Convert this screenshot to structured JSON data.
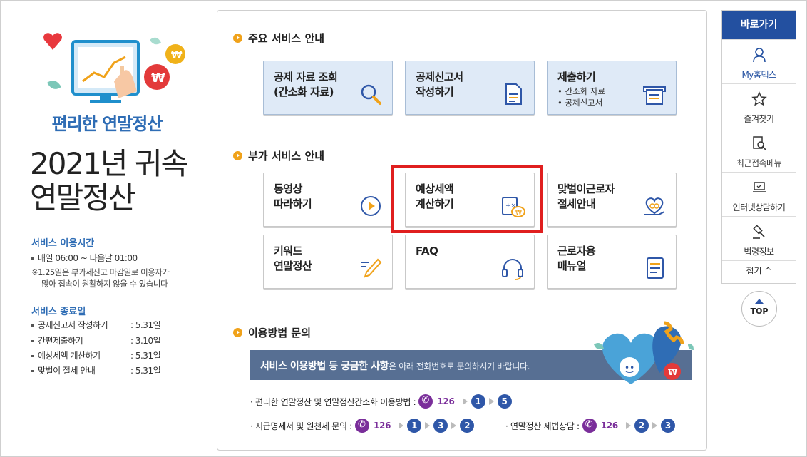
{
  "left": {
    "subtitle": "편리한 연말정산",
    "title_line1": "2021년 귀속",
    "title_line2": "연말정산",
    "service_hours": {
      "heading": "서비스 이용시간",
      "line1": "매일 06:00 ~ 다음날 01:00",
      "note1": "※1.25일은 부가세신고 마감일로 이용자가",
      "note2": "많아 접속이 원활하지 않을 수 있습니다"
    },
    "service_end": {
      "heading": "서비스 종료일",
      "items": [
        {
          "label": "공제신고서 작성하기",
          "date": ": 5.31일"
        },
        {
          "label": "간편제출하기",
          "date": ": 3.10일"
        },
        {
          "label": "예상세액 계산하기",
          "date": ": 5.31일"
        },
        {
          "label": "맞벌이 절세 안내",
          "date": ": 5.31일"
        }
      ]
    }
  },
  "main": {
    "section1": "주요 서비스 안내",
    "section2": "부가 서비스 안내",
    "section3": "이용방법 문의",
    "main_cards": [
      {
        "title": "공제 자료 조회\n(간소화 자료)",
        "sub": "",
        "icon": "search-icon"
      },
      {
        "title": "공제신고서\n작성하기",
        "sub": "",
        "icon": "document-icon"
      },
      {
        "title": "제출하기",
        "sub": "• 간소화 자료\n• 공제신고서",
        "icon": "submit-tray-icon"
      }
    ],
    "extra_cards": [
      {
        "title": "동영상\n따라하기",
        "icon": "play-icon"
      },
      {
        "title": "예상세액\n계산하기",
        "icon": "calculator-icon"
      },
      {
        "title": "맞벌이근로자\n절세안내",
        "icon": "heart-hand-icon"
      },
      {
        "title": "키워드\n연말정산",
        "icon": "pencil-icon"
      },
      {
        "title": "FAQ",
        "icon": "headset-icon"
      },
      {
        "title": "근로자용\n매뉴얼",
        "icon": "manual-icon"
      }
    ],
    "banner": {
      "bold": "서비스 이용방법 등 궁금한 사항",
      "rest": "은 아래 전화번호로 문의하시기 바랍니다."
    },
    "contacts": {
      "line1_label": "· 편리한 연말정산 및 연말정산간소화 이용방법 :",
      "line1_number": "126",
      "line1_steps": [
        "1",
        "5"
      ],
      "line2_label": "· 지급명세서 및 원천세 문의 :",
      "line2_number": "126",
      "line2_steps": [
        "1",
        "3",
        "2"
      ],
      "line3_label": "· 연말정산 세법상담 :",
      "line3_number": "126",
      "line3_steps": [
        "2",
        "3"
      ]
    }
  },
  "quick": {
    "heading": "바로가기",
    "items": [
      "My홈택스",
      "즐겨찾기",
      "최근접속메뉴",
      "인터넷상담하기",
      "법령정보"
    ],
    "fold": "접기 ^",
    "top": "TOP"
  },
  "colors": {
    "accent_blue": "#2f6db5",
    "card_blue": "#dfeaf7",
    "highlight_red": "#e01f1f",
    "orange_bullet": "#f0a21a",
    "phone_purple": "#7a2e9a",
    "banner": "#576f93"
  }
}
